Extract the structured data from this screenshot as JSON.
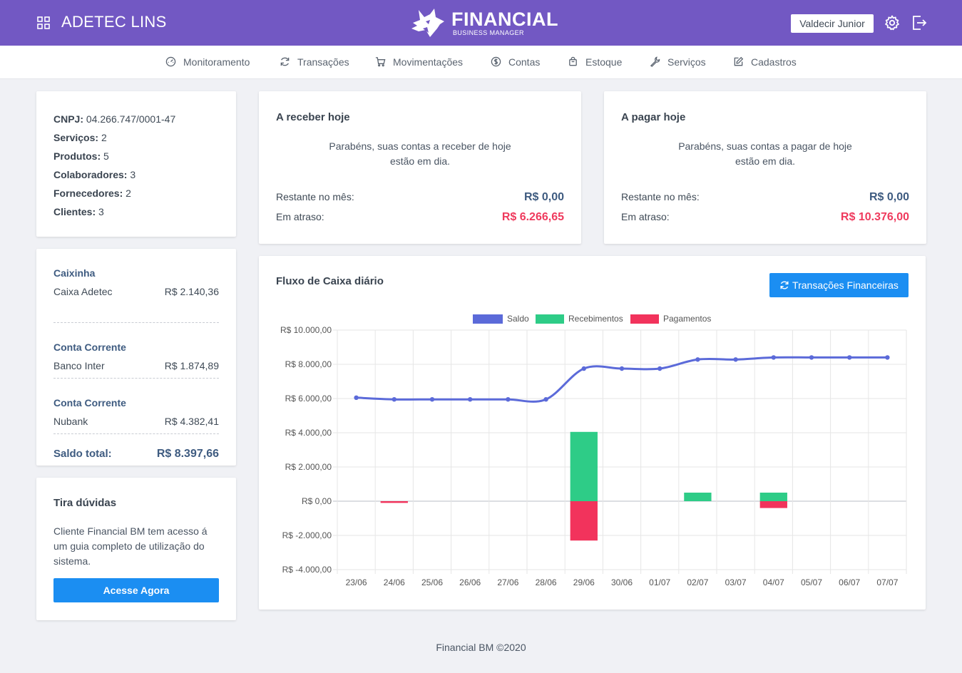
{
  "header": {
    "company": "ADETEC LINS",
    "brand_name": "FINANCIAL",
    "brand_sub": "BUSINESS MANAGER",
    "user": "Valdecir Junior"
  },
  "nav": [
    {
      "label": "Monitoramento",
      "icon": "gauge-icon"
    },
    {
      "label": "Transações",
      "icon": "refresh-icon"
    },
    {
      "label": "Movimentações",
      "icon": "cart-icon"
    },
    {
      "label": "Contas",
      "icon": "dollar-circle-icon"
    },
    {
      "label": "Estoque",
      "icon": "bag-icon"
    },
    {
      "label": "Serviços",
      "icon": "wrench-icon"
    },
    {
      "label": "Cadastros",
      "icon": "edit-icon"
    }
  ],
  "info": [
    {
      "label": "CNPJ:",
      "value": "04.266.747/0001-47"
    },
    {
      "label": "Serviços:",
      "value": "2"
    },
    {
      "label": "Produtos:",
      "value": "5"
    },
    {
      "label": "Colaboradores:",
      "value": "3"
    },
    {
      "label": "Fornecedores:",
      "value": "2"
    },
    {
      "label": "Clientes:",
      "value": "3"
    }
  ],
  "accounts": {
    "groups": [
      {
        "title": "Caixinha",
        "name": "Caixa Adetec",
        "value": "R$ 2.140,36"
      },
      {
        "title": "Conta Corrente",
        "name": "Banco Inter",
        "value": "R$ 1.874,89"
      },
      {
        "title": "Conta Corrente",
        "name": "Nubank",
        "value": "R$ 4.382,41"
      }
    ],
    "total_label": "Saldo total:",
    "total_value": "R$ 8.397,66"
  },
  "help": {
    "title": "Tira dúvidas",
    "text": "Cliente Financial BM tem acesso á um guia completo de utilização do sistema.",
    "button": "Acesse Agora"
  },
  "receive": {
    "title": "A receber hoje",
    "message_line1": "Parabéns, suas contas a receber de hoje",
    "message_line2": "estão em dia.",
    "remaining_label": "Restante no mês:",
    "remaining_value": "R$ 0,00",
    "late_label": "Em atraso:",
    "late_value": "R$ 6.266,65"
  },
  "pay": {
    "title": "A pagar hoje",
    "message_line1": "Parabéns, suas contas a pagar de hoje",
    "message_line2": "estão em dia.",
    "remaining_label": "Restante no mês:",
    "remaining_value": "R$ 0,00",
    "late_label": "Em atraso:",
    "late_value": "R$ 10.376,00"
  },
  "cashflow": {
    "title": "Fluxo de Caixa diário",
    "button": "Transações Financeiras"
  },
  "colors": {
    "header": "#7258c3",
    "primary": "#1b8ef2",
    "saldo": "#5b6ad9",
    "recebimentos": "#2ecc87",
    "pagamentos": "#f2335c"
  },
  "chart_data": {
    "type": "bar",
    "categories": [
      "23/06",
      "24/06",
      "25/06",
      "26/06",
      "27/06",
      "28/06",
      "29/06",
      "30/06",
      "01/07",
      "02/07",
      "03/07",
      "04/07",
      "05/07",
      "06/07",
      "07/07"
    ],
    "series": [
      {
        "name": "Saldo",
        "type": "line",
        "values": [
          6050,
          5950,
          5950,
          5950,
          5950,
          5950,
          7750,
          7750,
          7750,
          8280,
          8280,
          8400,
          8400,
          8400,
          8400
        ]
      },
      {
        "name": "Recebimentos",
        "type": "bar",
        "values": [
          0,
          0,
          0,
          0,
          0,
          0,
          4050,
          0,
          0,
          500,
          0,
          500,
          0,
          0,
          0
        ]
      },
      {
        "name": "Pagamentos",
        "type": "bar",
        "values": [
          0,
          -100,
          0,
          0,
          0,
          0,
          -2300,
          0,
          0,
          0,
          0,
          -400,
          0,
          0,
          0
        ]
      }
    ],
    "yticks": [
      "R$ 10.000,00",
      "R$ 8.000,00",
      "R$ 6.000,00",
      "R$ 4.000,00",
      "R$ 2.000,00",
      "R$ 0,00",
      "R$ -2.000,00",
      "R$ -4.000,00"
    ],
    "ylim": [
      -4000,
      10000
    ],
    "grid": true,
    "legend": "top"
  },
  "footer": "Financial BM ©2020"
}
